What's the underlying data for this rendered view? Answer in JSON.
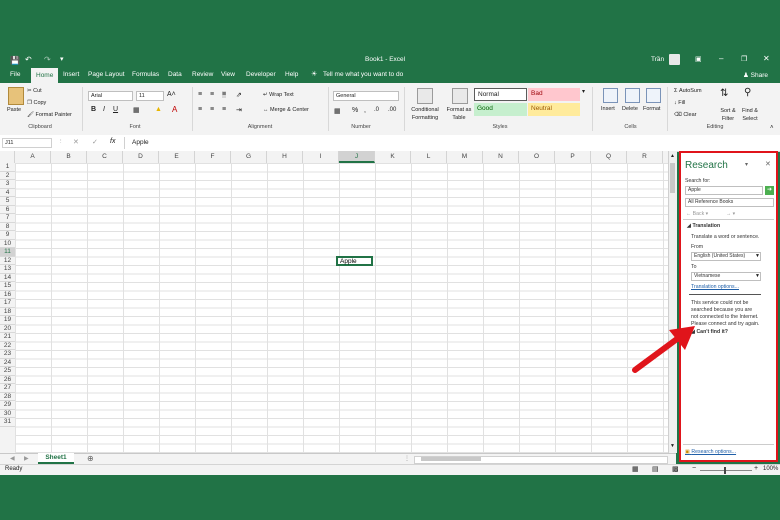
{
  "window": {
    "title": "Book1 - Excel",
    "user": "Trần",
    "share_label": "Share",
    "tell_me": "Tell me what you want to do"
  },
  "tabs": [
    "File",
    "Home",
    "Insert",
    "Page Layout",
    "Formulas",
    "Data",
    "Review",
    "View",
    "Developer",
    "Help"
  ],
  "ribbon": {
    "clipboard": {
      "paste": "Paste",
      "cut": "Cut",
      "copy": "Copy",
      "format_painter": "Format Painter",
      "label": "Clipboard"
    },
    "font": {
      "name": "Arial",
      "size": "11",
      "label": "Font"
    },
    "alignment": {
      "wrap_text": "Wrap Text",
      "merge_center": "Merge & Center",
      "label": "Alignment"
    },
    "number": {
      "format": "General",
      "label": "Number"
    },
    "styles": {
      "conditional": "Conditional Formatting",
      "format_table": "Format as Table",
      "normal": "Normal",
      "bad": "Bad",
      "good": "Good",
      "neutral": "Neutral",
      "label": "Styles"
    },
    "cells": {
      "insert": "Insert",
      "delete": "Delete",
      "format": "Format",
      "label": "Cells"
    },
    "editing": {
      "autosum": "AutoSum",
      "fill": "Fill",
      "clear": "Clear",
      "sort_filter": "Sort & Filter",
      "find_select": "Find & Select",
      "label": "Editing"
    }
  },
  "formula_bar": {
    "name_box": "J11",
    "fx": "fx",
    "value": "Apple"
  },
  "grid": {
    "columns": [
      "A",
      "B",
      "C",
      "D",
      "E",
      "F",
      "G",
      "H",
      "I",
      "J",
      "K",
      "L",
      "M",
      "N",
      "O",
      "P",
      "Q",
      "R"
    ],
    "rows": [
      "1",
      "2",
      "3",
      "4",
      "5",
      "6",
      "7",
      "8",
      "9",
      "10",
      "11",
      "12",
      "13",
      "14",
      "15",
      "16",
      "17",
      "18",
      "19",
      "20",
      "21",
      "22",
      "23",
      "24",
      "25",
      "26",
      "27",
      "28",
      "29",
      "30",
      "31"
    ],
    "active_cell_value": "Apple"
  },
  "sheet_tab": "Sheet1",
  "status": {
    "ready": "Ready",
    "zoom": "100%"
  },
  "research": {
    "title": "Research",
    "search_for_label": "Search for:",
    "search_value": "Apple",
    "source": "All Reference Books",
    "back": "Back",
    "translation_heading": "Translation",
    "translate_hint": "Translate a word or sentence.",
    "from_label": "From",
    "from_value": "English (United States)",
    "to_label": "To",
    "to_value": "Vietnamese",
    "translation_options": "Translation options...",
    "error_message_1": "This service could not be",
    "error_message_2": "searched because you are",
    "error_message_3": "not connected to the Internet.",
    "error_message_4": "Please connect and try again.",
    "cant_find": "Can't find it?",
    "research_options": "Research options..."
  },
  "colors": {
    "excel_green": "#217346",
    "highlight_red": "#e0141b"
  }
}
